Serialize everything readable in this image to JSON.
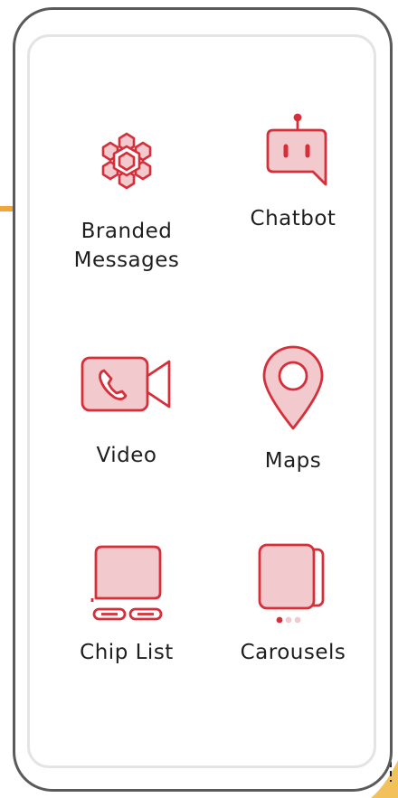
{
  "colors": {
    "accent_red": "#d62f3a",
    "fill_pink": "#f2c9cd",
    "frame_gray": "#5a5a5a",
    "screen_border": "#e4e4e4",
    "accent_orange": "#f2a53a",
    "label_text": "#1e1e1e"
  },
  "features": [
    {
      "label": "Branded\nMessages",
      "icon": "branded-messages-icon"
    },
    {
      "label": "Chatbot",
      "icon": "chatbot-icon"
    },
    {
      "label": "Video",
      "icon": "video-call-icon"
    },
    {
      "label": "Maps",
      "icon": "map-pin-icon"
    },
    {
      "label": "Chip List",
      "icon": "chip-list-icon"
    },
    {
      "label": "Carousels",
      "icon": "carousel-icon"
    }
  ]
}
